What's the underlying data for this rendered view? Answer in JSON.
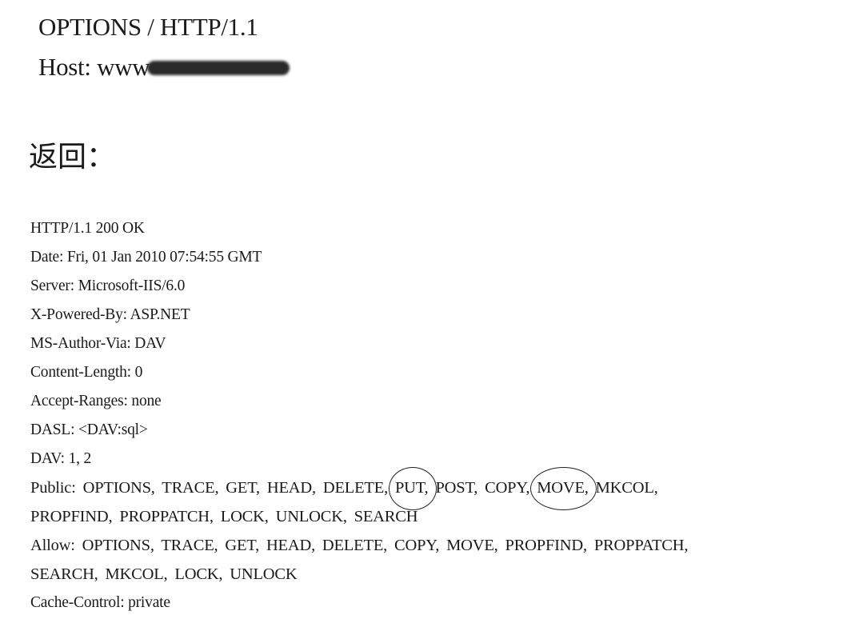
{
  "request": {
    "method_line": "OPTIONS / HTTP/1.1",
    "host_label": "Host: www"
  },
  "return_label": "返回：",
  "response": {
    "status": "HTTP/1.1 200 OK",
    "date": "Date: Fri, 01 Jan 2010 07:54:55 GMT",
    "server": "Server: Microsoft-IIS/6.0",
    "powered_by": "X-Powered-By: ASP.NET",
    "author_via": "MS-Author-Via: DAV",
    "content_length": "Content-Length: 0",
    "accept_ranges": "Accept-Ranges: none",
    "dasl": "DASL: <DAV:sql>",
    "dav": "DAV: 1, 2",
    "public_1a": "Public: OPTIONS, TRACE, GET, HEAD, DELETE,",
    "public_put": "PUT,",
    "public_1b": "POST, COPY,",
    "public_move": "MOVE,",
    "public_1c": "MKCOL,",
    "public_2": "PROPFIND, PROPPATCH, LOCK, UNLOCK, SEARCH",
    "allow_1": "Allow: OPTIONS, TRACE, GET, HEAD, DELETE, COPY, MOVE, PROPFIND, PROPPATCH,",
    "allow_2": "SEARCH, MKCOL, LOCK, UNLOCK",
    "cache_control": "Cache-Control: private"
  }
}
